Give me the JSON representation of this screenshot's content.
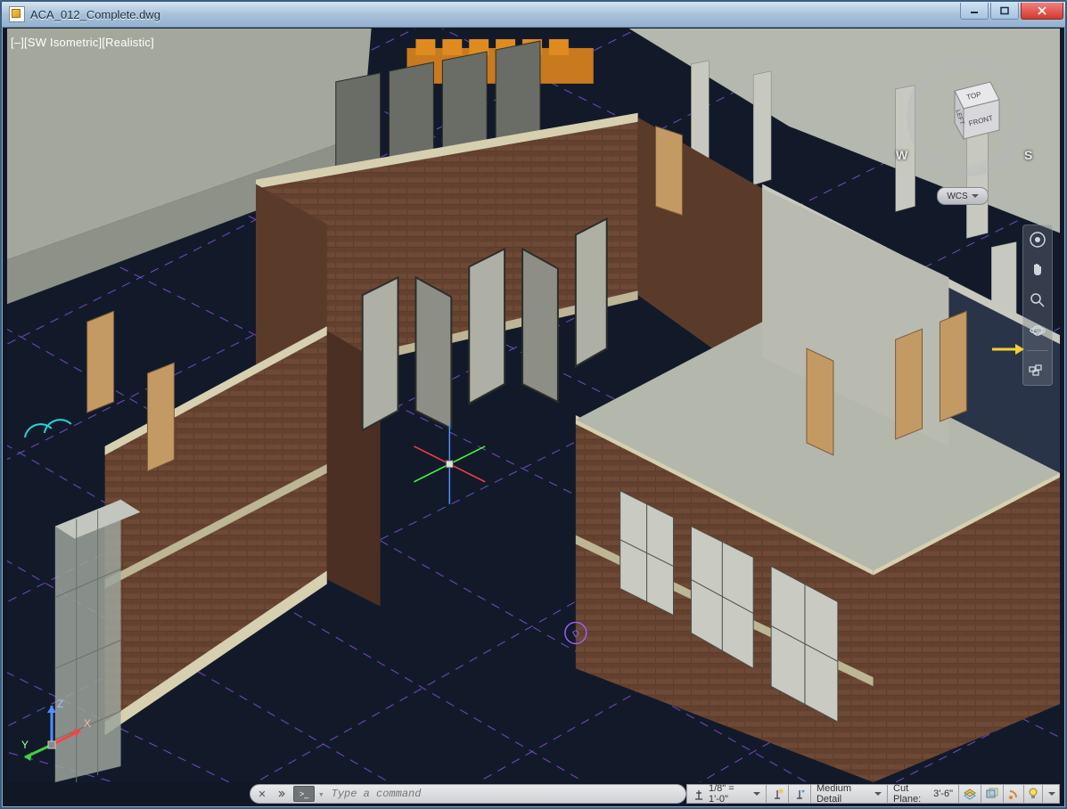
{
  "window": {
    "title": "ACA_012_Complete.dwg"
  },
  "viewport": {
    "control_label": "[–][SW Isometric][Realistic]"
  },
  "viewcube": {
    "top_label": "TOP",
    "left_label": "LEFT",
    "front_label": "FRONT",
    "compass_w": "W",
    "compass_s": "S",
    "wcs_label": "WCS"
  },
  "ucs": {
    "x": "X",
    "y": "Y",
    "z": "Z"
  },
  "command": {
    "placeholder": "Type a command"
  },
  "status": {
    "scale_value": "1/8\" = 1'-0\"",
    "detail_value": "Medium Detail",
    "cutplane_label": "Cut Plane:",
    "cutplane_value": "3'-6\""
  }
}
